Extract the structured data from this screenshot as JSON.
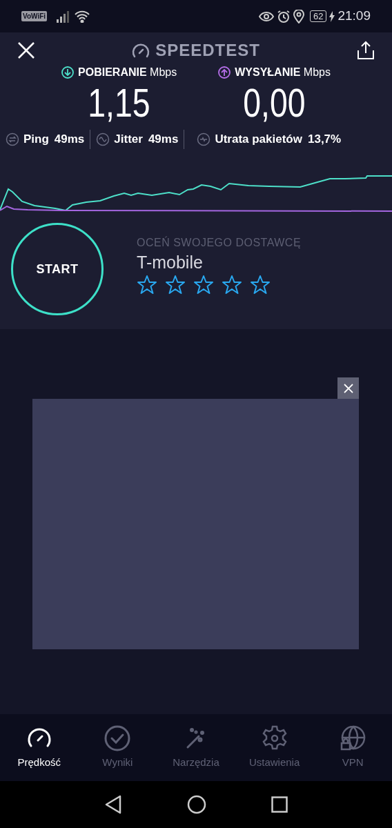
{
  "status_bar": {
    "vowifi": "VoWiFi",
    "battery": "62",
    "time": "21:09"
  },
  "header": {
    "title": "SPEEDTEST"
  },
  "speeds": [
    {
      "kind": "download",
      "label": "POBIERANIE",
      "unit": "Mbps",
      "value": "1,15"
    },
    {
      "kind": "upload",
      "label": "WYSYŁANIE",
      "unit": "Mbps",
      "value": "0,00"
    }
  ],
  "metrics": [
    {
      "kind": "ping",
      "label": "Ping",
      "value": "49ms"
    },
    {
      "kind": "jitter",
      "label": "Jitter",
      "value": "49ms"
    },
    {
      "kind": "loss",
      "label": "Utrata pakietów",
      "value": "13,7%"
    }
  ],
  "start_button": "START",
  "rating": {
    "prompt": "OCEŃ SWOJEGO DOSTAWCĘ",
    "provider": "T-mobile",
    "stars": 0
  },
  "ad": {
    "kind": "blank"
  },
  "tabs": [
    {
      "kind": "speed",
      "label": "Prędkość",
      "selected": true
    },
    {
      "kind": "results",
      "label": "Wyniki",
      "selected": false
    },
    {
      "kind": "tools",
      "label": "Narzędzia",
      "selected": false
    },
    {
      "kind": "settings",
      "label": "Ustawienia",
      "selected": false
    },
    {
      "kind": "vpn",
      "label": "VPN",
      "selected": false
    }
  ]
}
